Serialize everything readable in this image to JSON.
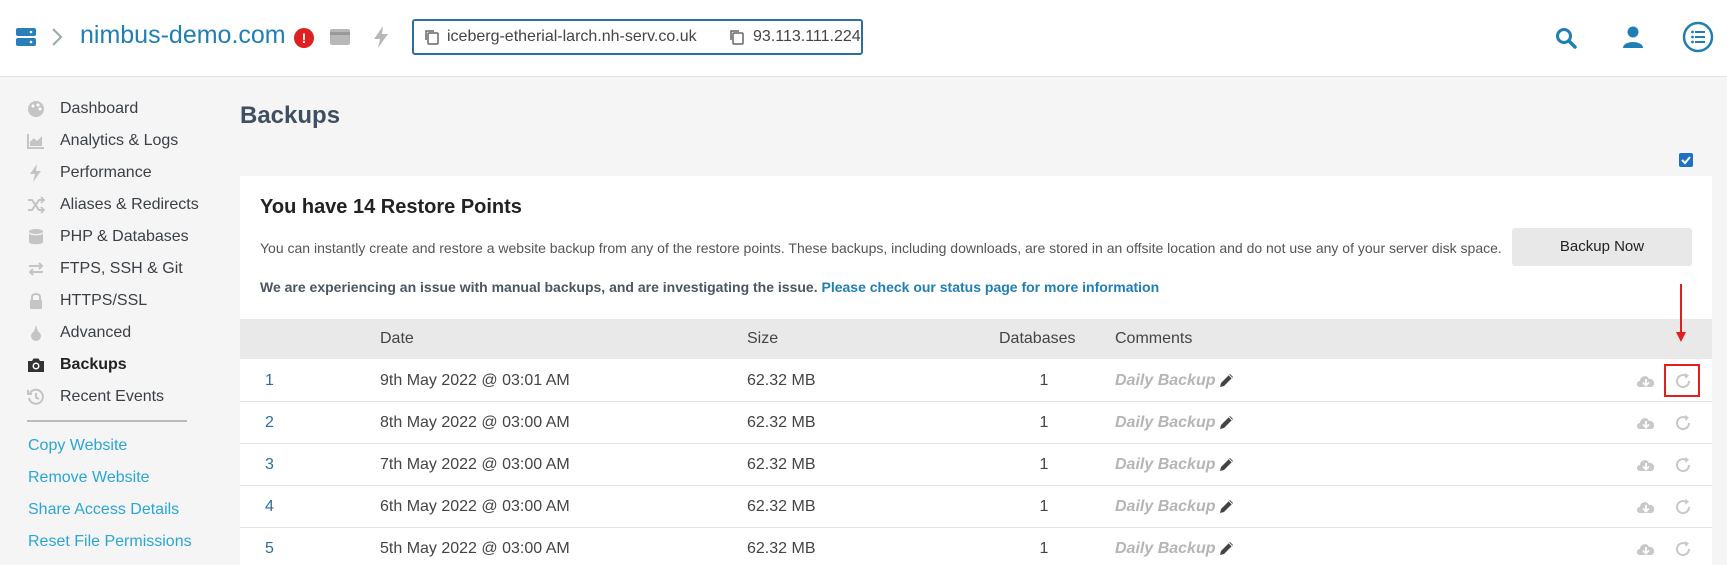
{
  "header": {
    "site_name": "nimbus-demo.com",
    "alert_badge": "!",
    "hostname": "iceberg-etherial-larch.nh-serv.co.uk",
    "ip_address": "93.113.111.224",
    "accent_color": "#1f7fb5",
    "alert_color": "#e01f1f"
  },
  "sidebar": {
    "items": [
      {
        "label": "Dashboard",
        "icon": "palette-icon"
      },
      {
        "label": "Analytics & Logs",
        "icon": "area-chart-icon"
      },
      {
        "label": "Performance",
        "icon": "bolt-icon"
      },
      {
        "label": "Aliases & Redirects",
        "icon": "shuffle-icon"
      },
      {
        "label": "PHP & Databases",
        "icon": "database-icon"
      },
      {
        "label": "FTPS, SSH & Git",
        "icon": "exchange-icon"
      },
      {
        "label": "HTTPS/SSL",
        "icon": "lock-icon"
      },
      {
        "label": "Advanced",
        "icon": "wizard-icon"
      },
      {
        "label": "Backups",
        "icon": "camera-icon",
        "active": true
      },
      {
        "label": "Recent Events",
        "icon": "history-icon"
      }
    ],
    "links": [
      "Copy Website",
      "Remove Website",
      "Share Access Details",
      "Reset File Permissions"
    ],
    "link_color": "#2aa6d6"
  },
  "main": {
    "title": "Backups",
    "heading": "You have 14 Restore Points",
    "description": "You can instantly create and restore a website backup from any of the restore points. These backups, including downloads, are stored in an offsite location and do not use any of your server disk space.",
    "notice": "We are experiencing an issue with manual backups, and are investigating the issue.",
    "notice_link": "Please check our status page for more information",
    "backup_button": "Backup Now",
    "table": {
      "headers": [
        "Date",
        "Size",
        "Databases",
        "Comments"
      ],
      "rows": [
        {
          "num": "1",
          "date": "9th May 2022 @ 03:01 AM",
          "size": "62.32 MB",
          "databases": "1",
          "comment": "Daily Backup"
        },
        {
          "num": "2",
          "date": "8th May 2022 @ 03:00 AM",
          "size": "62.32 MB",
          "databases": "1",
          "comment": "Daily Backup"
        },
        {
          "num": "3",
          "date": "7th May 2022 @ 03:00 AM",
          "size": "62.32 MB",
          "databases": "1",
          "comment": "Daily Backup"
        },
        {
          "num": "4",
          "date": "6th May 2022 @ 03:00 AM",
          "size": "62.32 MB",
          "databases": "1",
          "comment": "Daily Backup"
        },
        {
          "num": "5",
          "date": "5th May 2022 @ 03:00 AM",
          "size": "62.32 MB",
          "databases": "1",
          "comment": "Daily Backup"
        }
      ]
    }
  }
}
